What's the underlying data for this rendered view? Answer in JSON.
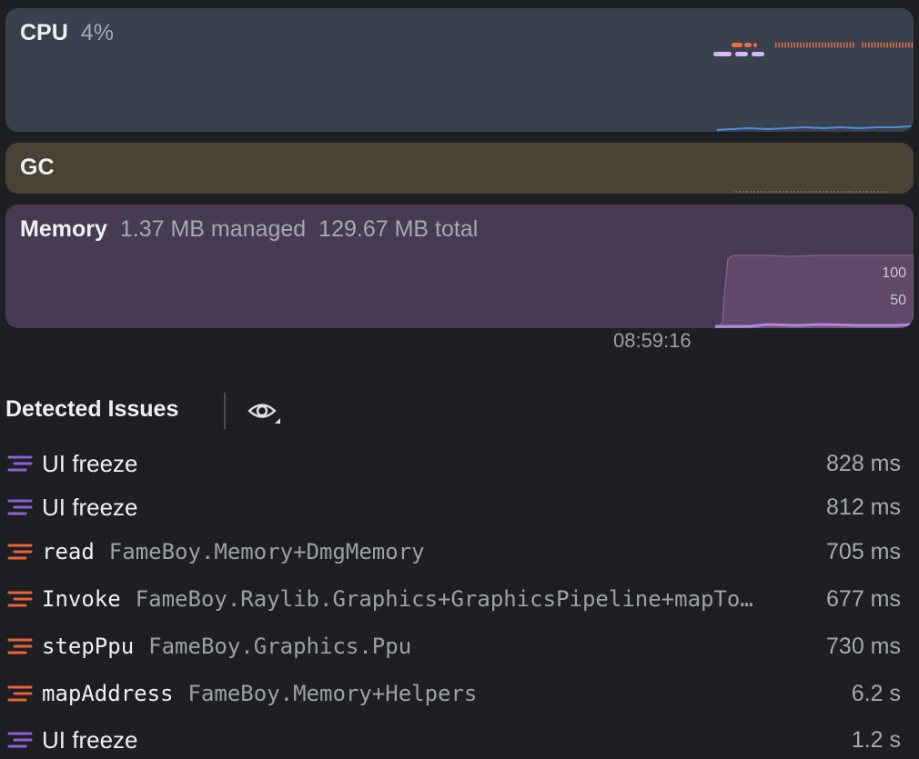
{
  "cpu": {
    "title": "CPU",
    "value": "4%"
  },
  "gc": {
    "title": "GC"
  },
  "memory": {
    "title": "Memory",
    "managed": "1.37 MB managed",
    "total": "129.67 MB total",
    "axis_labels": [
      "100",
      "50"
    ]
  },
  "timeline": {
    "timestamp": "08:59:16"
  },
  "issues": {
    "title": "Detected Issues",
    "items": [
      {
        "kind": "ui-freeze",
        "name": "UI freeze",
        "detail": "",
        "duration": "828 ms"
      },
      {
        "kind": "ui-freeze",
        "name": "UI freeze",
        "detail": "",
        "duration": "812 ms"
      },
      {
        "kind": "hot-method",
        "name": "read",
        "detail": "FameBoy.Memory+DmgMemory",
        "duration": "705 ms"
      },
      {
        "kind": "hot-method",
        "name": "Invoke",
        "detail": "FameBoy.Raylib.Graphics+GraphicsPipeline+mapTo…",
        "duration": "677 ms"
      },
      {
        "kind": "hot-method",
        "name": "stepPpu",
        "detail": "FameBoy.Graphics.Ppu",
        "duration": "730 ms"
      },
      {
        "kind": "hot-method",
        "name": "mapAddress",
        "detail": "FameBoy.Memory+Helpers",
        "duration": "6.2 s"
      },
      {
        "kind": "ui-freeze",
        "name": "UI freeze",
        "detail": "",
        "duration": "1.2 s"
      }
    ]
  },
  "colors": {
    "ui_freeze": "#8a63d2",
    "hot_method": "#e8633a",
    "cpu_marks": "#e8703f",
    "cpu_marks_light": "#d7b8f0",
    "cpu_line": "#4a8fe0",
    "memory_fill": "#5f4868",
    "memory_line": "#b784e8"
  }
}
